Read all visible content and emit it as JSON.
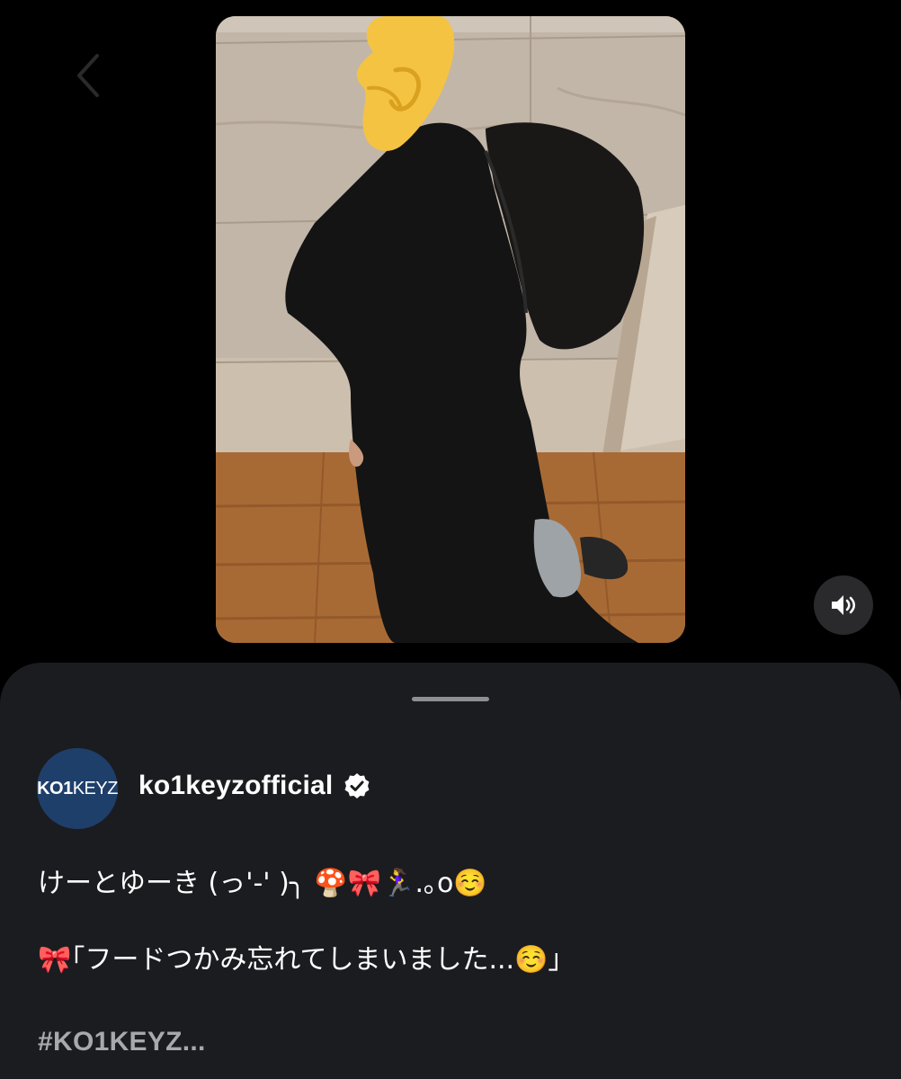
{
  "header": {
    "back_icon": "chevron-left-icon"
  },
  "video": {
    "sticker_icon": "pinching-hand-emoji",
    "mute_icon": "speaker-icon"
  },
  "sheet": {
    "avatar_text_bold": "KO1",
    "avatar_text_light": "KEYZ",
    "username": "ko1keyzofficial",
    "verified_icon": "verified-badge-icon",
    "caption_line1": "けーとゆーき (っ'-' )╮ 🍄🎀🏃‍♀️.｡o☺️",
    "caption_line2": "🎀｢フードつかみ忘れてしまいました...☺️｣",
    "hashtag": "#KO1KEYZ..."
  },
  "colors": {
    "background": "#000000",
    "sheet": "#1b1c20",
    "avatar": "#1f3f6b",
    "text": "#ffffff",
    "muted_text": "#a8a8ad"
  }
}
